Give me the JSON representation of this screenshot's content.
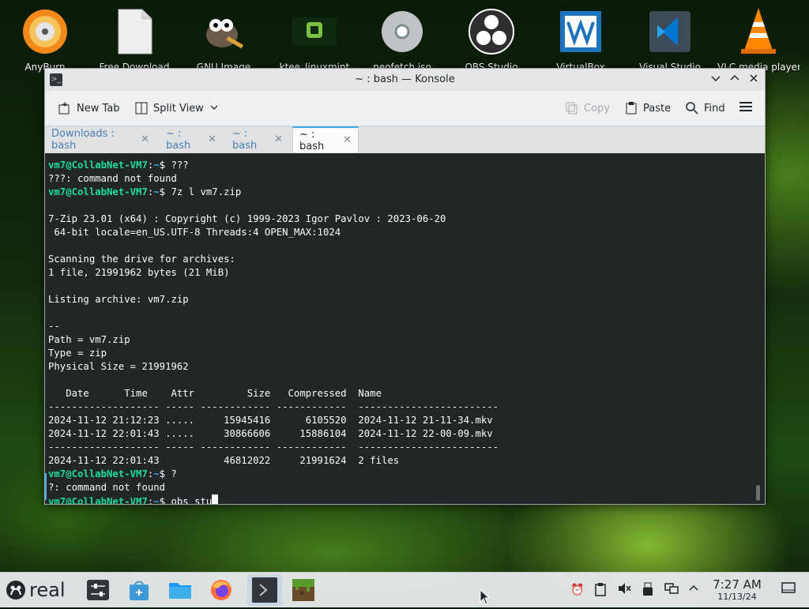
{
  "desktop_icons": [
    {
      "name": "anyburn",
      "label": "AnyBurn",
      "icon": "anyburn-disc-icon"
    },
    {
      "name": "free-download",
      "label": "Free Download",
      "icon": "document-file-icon"
    },
    {
      "name": "gnu-image",
      "label": "GNU Image",
      "icon": "gimp-icon"
    },
    {
      "name": "ktee-linuxmint",
      "label": "ktee_linuxmint",
      "icon": "linux-mint-icon"
    },
    {
      "name": "neofetch-iso",
      "label": "neofetch.iso",
      "icon": "optical-disc-icon"
    },
    {
      "name": "obs-studio",
      "label": "OBS Studio",
      "icon": "obs-icon"
    },
    {
      "name": "virtualbox",
      "label": "VirtualBox",
      "icon": "virtualbox-icon"
    },
    {
      "name": "visual-studio",
      "label": "Visual Studio",
      "icon": "vscode-icon"
    },
    {
      "name": "vlc",
      "label": "VLC media player",
      "icon": "vlc-cone-icon"
    }
  ],
  "window": {
    "title": "~ : bash — Konsole",
    "toolbar": {
      "new_tab": "New Tab",
      "split_view": "Split View",
      "copy": "Copy",
      "paste": "Paste",
      "find": "Find"
    },
    "tabs": [
      {
        "label": "Downloads : bash",
        "active": false
      },
      {
        "label": "~ : bash",
        "active": false
      },
      {
        "label": "~ : bash",
        "active": false
      },
      {
        "label": "~ : bash",
        "active": true
      }
    ]
  },
  "terminal": {
    "prompt_user": "vm7@CollabNet-VM7",
    "prompt_sep": ":",
    "prompt_path": "~",
    "prompt_suffix": "$ ",
    "lines": [
      {
        "prompt": true,
        "text": "???"
      },
      {
        "text": "???: command not found"
      },
      {
        "prompt": true,
        "text": "7z l vm7.zip"
      },
      {
        "text": ""
      },
      {
        "text": "7-Zip 23.01 (x64) : Copyright (c) 1999-2023 Igor Pavlov : 2023-06-20"
      },
      {
        "text": " 64-bit locale=en_US.UTF-8 Threads:4 OPEN_MAX:1024"
      },
      {
        "text": ""
      },
      {
        "text": "Scanning the drive for archives:"
      },
      {
        "text": "1 file, 21991962 bytes (21 MiB)"
      },
      {
        "text": ""
      },
      {
        "text": "Listing archive: vm7.zip"
      },
      {
        "text": ""
      },
      {
        "text": "--"
      },
      {
        "text": "Path = vm7.zip"
      },
      {
        "text": "Type = zip"
      },
      {
        "text": "Physical Size = 21991962"
      },
      {
        "text": ""
      },
      {
        "text": "   Date      Time    Attr         Size   Compressed  Name"
      },
      {
        "text": "------------------- ----- ------------ ------------  ------------------------"
      },
      {
        "text": "2024-11-12 21:12:23 .....     15945416      6105520  2024-11-12 21-11-34.mkv"
      },
      {
        "text": "2024-11-12 22:01:43 .....     30866606     15886104  2024-11-12 22-00-09.mkv"
      },
      {
        "text": "------------------- ----- ------------ ------------  ------------------------"
      },
      {
        "text": "2024-11-12 22:01:43           46812022     21991624  2 files"
      },
      {
        "prompt": true,
        "text": "?"
      },
      {
        "text": "?: command not found"
      },
      {
        "prompt": true,
        "text": "obs stu",
        "cursor": true
      }
    ]
  },
  "taskbar": {
    "start_label": "real",
    "apps": [
      {
        "name": "system-settings",
        "icon": "settings-sliders-icon"
      },
      {
        "name": "discover",
        "icon": "store-bag-icon"
      },
      {
        "name": "file-manager",
        "icon": "folder-icon"
      },
      {
        "name": "firefox",
        "icon": "firefox-icon"
      },
      {
        "name": "konsole",
        "icon": "terminal-icon",
        "active": true
      },
      {
        "name": "minecraft",
        "icon": "minecraft-block-icon"
      }
    ],
    "clock_time": "7:27 AM",
    "clock_date": "11/13/24"
  }
}
